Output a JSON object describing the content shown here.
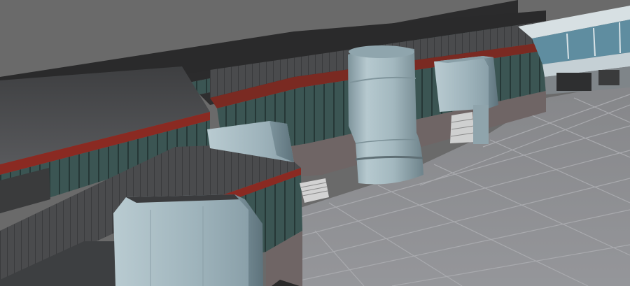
{
  "scene": {
    "type": "3d-level-editor-viewport",
    "palette": {
      "sky": "#6a6a6a",
      "floor": "#8d8e92",
      "floor_grid": "#a7a8ac",
      "roof_dark": "#2a2a2a",
      "roof_panel": "#4a4b4d",
      "window_teal": "#3d5856",
      "red_stripe": "#8a2a22",
      "vent_blue": "#9eb3bb",
      "vent_blue_dark": "#6f858e",
      "terminal_glass": "#5f8da0",
      "terminal_wall": "#c8d3d8"
    }
  }
}
